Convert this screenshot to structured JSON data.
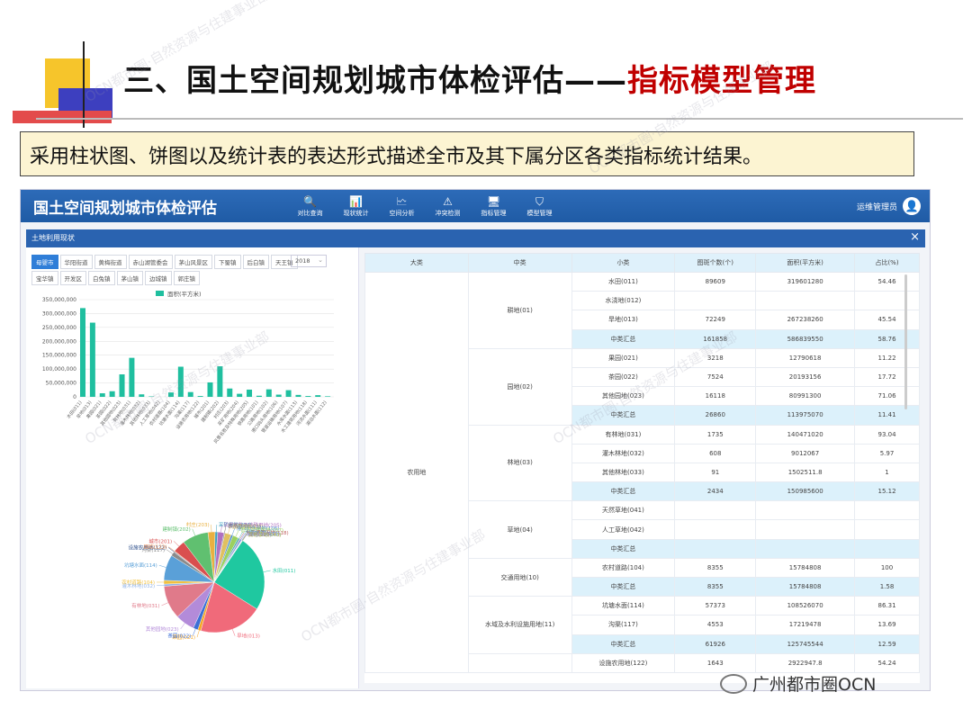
{
  "slide": {
    "title_main": "三、国土空间规划城市体检评估——",
    "title_accent": "指标模型管理",
    "subtitle": "采用柱状图、饼图以及统计表的表达形式描述全市及其下属分区各类指标统计结果。",
    "footer": "广州都市圈OCN",
    "watermark": "OCN都市圈·自然资源与住建事业部"
  },
  "app": {
    "title": "国土空间规划城市体检评估",
    "nav": [
      {
        "label": "对比查询",
        "icon": "🔍"
      },
      {
        "label": "现状统计",
        "icon": "📊"
      },
      {
        "label": "空间分析",
        "icon": "🗠"
      },
      {
        "label": "冲突检测",
        "icon": "⚠"
      },
      {
        "label": "指标管理",
        "icon": "🖥"
      },
      {
        "label": "模型管理",
        "icon": "⛉"
      }
    ],
    "user": "运维管理员",
    "panel_title": "土地利用现状",
    "close": "×",
    "tabs": [
      "母婴市",
      "华阳街道",
      "黄梅街道",
      "赤山湖管委会",
      "茅山风景区",
      "下蜀镇",
      "后白镇",
      "天王镇",
      "宝华镇",
      "开发区",
      "白兔镇",
      "茅山镇",
      "边城镇",
      "郭庄镇"
    ],
    "year": "2018"
  },
  "colors": {
    "bar": "#1fbf9f",
    "header_bg": "#2a63b0",
    "highlight": "#dcf1fb"
  },
  "chart_data": [
    {
      "type": "bar",
      "legend": "面积(平方米)",
      "ylim": [
        0,
        350000000
      ],
      "yticks": [
        "0",
        "50,000,000",
        "100,000,000",
        "150,000,000",
        "200,000,000",
        "250,000,000",
        "300,000,000",
        "350,000,000"
      ],
      "x_labels": [
        "水田(011)",
        "早地(013)",
        "果园(021)",
        "茶园(022)",
        "其他园地(023)",
        "有林地(031)",
        "灌木林地(032)",
        "其他林地(033)",
        "人工草地(042)",
        "农村道路(104)",
        "坑塘水面(114)",
        "沟渠(117)",
        "设施农用地(122)",
        "城市(201)",
        "建制镇(202)",
        "村庄(203)",
        "采矿用地(204)",
        "风景名胜及特殊用地(205)",
        "铁路用地(101)",
        "公路用地(102)",
        "港口码头用地(106)",
        "管道运输用地(107)",
        "水库水面(113)",
        "水工建筑用地(118)",
        "河流水面(111)",
        "湖泊水面(112)"
      ],
      "values": [
        319601280,
        267238260,
        12790618,
        20193156,
        80991300,
        140471020,
        9012067,
        1502511.8,
        0,
        15784808,
        108526070,
        17219478,
        2922947.8,
        52000000,
        110000000,
        30000000,
        11000000,
        26000000,
        4000000,
        27000000,
        8000000,
        24000000,
        7000000,
        3000000,
        6000000,
        2000000
      ]
    },
    {
      "type": "pie",
      "labels": [
        "水田(011)",
        "旱地(013)",
        "果园(021)",
        "茶园(022)",
        "其他园地(023)",
        "有林地(031)",
        "灌木林地(032)",
        "农村道路(104)",
        "坑塘水面(114)",
        "沟渠(117)",
        "设施农用地(122)",
        "田坎(123)",
        "城市(201)",
        "建制镇(202)",
        "村庄(203)",
        "采矿用地(204)",
        "风景名胜及特殊用地(205)",
        "铁路用地(101)",
        "公路用地(102)",
        "港口码头用地(106)",
        "管道运输用地(107)",
        "水库水面(113)",
        "水工建筑用地(118)",
        "河流水面(111)",
        "湖泊水面(112)",
        "内陆滩涂(116)",
        "其他草地(043)",
        "裸地(127)"
      ],
      "values": [
        319601280,
        267238260,
        12790618,
        20193156,
        80991300,
        140471020,
        9012067,
        15784808,
        108526070,
        17219478,
        2922947.8,
        3000000,
        52000000,
        110000000,
        30000000,
        11000000,
        26000000,
        4000000,
        27000000,
        8000000,
        24000000,
        7000000,
        3000000,
        6000000,
        2000000,
        1500000,
        1000000,
        800000
      ],
      "colors": [
        "#1fc8a0",
        "#f06a7a",
        "#f5a623",
        "#3b6fd6",
        "#b38bd9",
        "#e07a8a",
        "#8fb3e8",
        "#f0c040",
        "#5aa0d8",
        "#8a8a8a",
        "#2c4e8a",
        "#f28a4a",
        "#d94f4f",
        "#60c070",
        "#e8b040",
        "#3ba0c0",
        "#b070c0",
        "#707070",
        "#e0c060",
        "#4f90d0",
        "#9cd060",
        "#40b0b0",
        "#c06060",
        "#6080e0",
        "#d0a0d0",
        "#80c0e0",
        "#c0c040",
        "#909090"
      ]
    }
  ],
  "table": {
    "headers": [
      "大类",
      "中类",
      "小类",
      "图斑个数(个)",
      "面积(平方米)",
      "占比(%)"
    ],
    "big": "农用地",
    "groups": [
      {
        "mid": "耕地(01)",
        "rows": [
          {
            "s": "水田(011)",
            "n": "89609",
            "a": "319601280",
            "p": "54.46",
            "hl": false
          },
          {
            "s": "水浇地(012)",
            "n": "",
            "a": "",
            "p": "",
            "hl": false
          },
          {
            "s": "旱地(013)",
            "n": "72249",
            "a": "267238260",
            "p": "45.54",
            "hl": false
          },
          {
            "s": "中类汇总",
            "n": "161858",
            "a": "586839550",
            "p": "58.76",
            "hl": true
          }
        ]
      },
      {
        "mid": "园地(02)",
        "rows": [
          {
            "s": "果园(021)",
            "n": "3218",
            "a": "12790618",
            "p": "11.22",
            "hl": false
          },
          {
            "s": "茶园(022)",
            "n": "7524",
            "a": "20193156",
            "p": "17.72",
            "hl": false
          },
          {
            "s": "其他园地(023)",
            "n": "16118",
            "a": "80991300",
            "p": "71.06",
            "hl": false
          },
          {
            "s": "中类汇总",
            "n": "26860",
            "a": "113975070",
            "p": "11.41",
            "hl": true
          }
        ]
      },
      {
        "mid": "林地(03)",
        "rows": [
          {
            "s": "有林地(031)",
            "n": "1735",
            "a": "140471020",
            "p": "93.04",
            "hl": false
          },
          {
            "s": "灌木林地(032)",
            "n": "608",
            "a": "9012067",
            "p": "5.97",
            "hl": false
          },
          {
            "s": "其他林地(033)",
            "n": "91",
            "a": "1502511.8",
            "p": "1",
            "hl": false
          },
          {
            "s": "中类汇总",
            "n": "2434",
            "a": "150985600",
            "p": "15.12",
            "hl": true
          }
        ]
      },
      {
        "mid": "草地(04)",
        "rows": [
          {
            "s": "天然草地(041)",
            "n": "",
            "a": "",
            "p": "",
            "hl": false
          },
          {
            "s": "人工草地(042)",
            "n": "",
            "a": "",
            "p": "",
            "hl": false
          },
          {
            "s": "中类汇总",
            "n": "",
            "a": "",
            "p": "",
            "hl": true
          }
        ]
      },
      {
        "mid": "交通用地(10)",
        "rows": [
          {
            "s": "农村道路(104)",
            "n": "8355",
            "a": "15784808",
            "p": "100",
            "hl": false
          },
          {
            "s": "中类汇总",
            "n": "8355",
            "a": "15784808",
            "p": "1.58",
            "hl": true
          }
        ]
      },
      {
        "mid": "水域及水利设施用地(11)",
        "rows": [
          {
            "s": "坑塘水面(114)",
            "n": "57373",
            "a": "108526070",
            "p": "86.31",
            "hl": false
          },
          {
            "s": "沟渠(117)",
            "n": "4553",
            "a": "17219478",
            "p": "13.69",
            "hl": false
          },
          {
            "s": "中类汇总",
            "n": "61926",
            "a": "125745544",
            "p": "12.59",
            "hl": true
          }
        ]
      },
      {
        "mid": "",
        "rows": [
          {
            "s": "设施农用地(122)",
            "n": "1643",
            "a": "2922947.8",
            "p": "54.24",
            "hl": false
          }
        ]
      }
    ]
  }
}
